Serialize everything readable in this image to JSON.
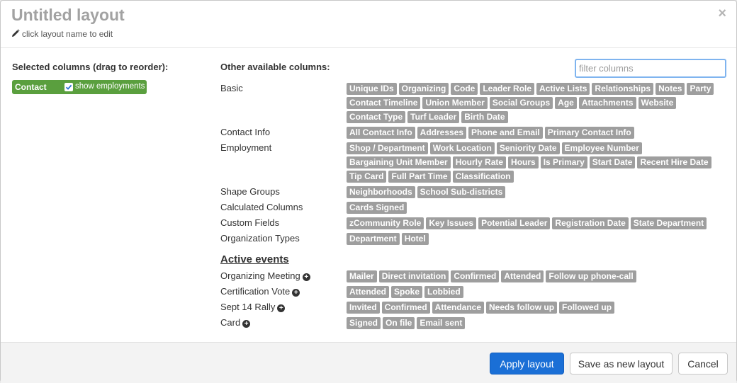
{
  "header": {
    "title": "Untitled layout",
    "edit_hint": "click layout name to edit",
    "close_glyph": "×"
  },
  "selected": {
    "heading": "Selected columns (drag to reorder):",
    "chip_label": "Contact",
    "checkbox_label": "show employments",
    "checkbox_checked": true
  },
  "other": {
    "heading": "Other available columns:",
    "filter_placeholder": "filter columns",
    "groups": [
      {
        "label": "Basic",
        "tags": [
          "Unique IDs",
          "Organizing",
          "Code",
          "Leader Role",
          "Active Lists",
          "Relationships",
          "Notes",
          "Party",
          "Contact Timeline",
          "Union Member",
          "Social Groups",
          "Age",
          "Attachments",
          "Website",
          "Contact Type",
          "Turf Leader",
          "Birth Date"
        ]
      },
      {
        "label": "Contact Info",
        "tags": [
          "All Contact Info",
          "Addresses",
          "Phone and Email",
          "Primary Contact Info"
        ]
      },
      {
        "label": "Employment",
        "tags": [
          "Shop / Department",
          "Work Location",
          "Seniority Date",
          "Employee Number",
          "Bargaining Unit Member",
          "Hourly Rate",
          "Hours",
          "Is Primary",
          "Start Date",
          "Recent Hire Date",
          "Tip Card",
          "Full Part Time",
          "Classification"
        ]
      },
      {
        "label": "Shape Groups",
        "tags": [
          "Neighborhoods",
          "School Sub-districts"
        ]
      },
      {
        "label": "Calculated Columns",
        "tags": [
          "Cards Signed"
        ]
      },
      {
        "label": "Custom Fields",
        "tags": [
          "zCommunity Role",
          "Key Issues",
          "Potential Leader",
          "Registration Date",
          "State Department"
        ]
      },
      {
        "label": "Organization Types",
        "tags": [
          "Department",
          "Hotel"
        ]
      }
    ]
  },
  "events": {
    "title": "Active events",
    "groups": [
      {
        "label": "Organizing Meeting",
        "tags": [
          "Mailer",
          "Direct invitation",
          "Confirmed",
          "Attended",
          "Follow up phone-call"
        ]
      },
      {
        "label": "Certification Vote",
        "tags": [
          "Attended",
          "Spoke",
          "Lobbied"
        ]
      },
      {
        "label": "Sept 14 Rally",
        "tags": [
          "Invited",
          "Confirmed",
          "Attendance",
          "Needs follow up",
          "Followed up"
        ]
      },
      {
        "label": "Card",
        "tags": [
          "Signed",
          "On file",
          "Email sent"
        ]
      }
    ]
  },
  "footer": {
    "apply_label": "Apply layout",
    "save_label": "Save as new layout",
    "cancel_label": "Cancel"
  },
  "colors": {
    "tag_bg": "#9e9e9e",
    "chip_bg": "#5a9f3e",
    "primary": "#1a6fd6"
  }
}
